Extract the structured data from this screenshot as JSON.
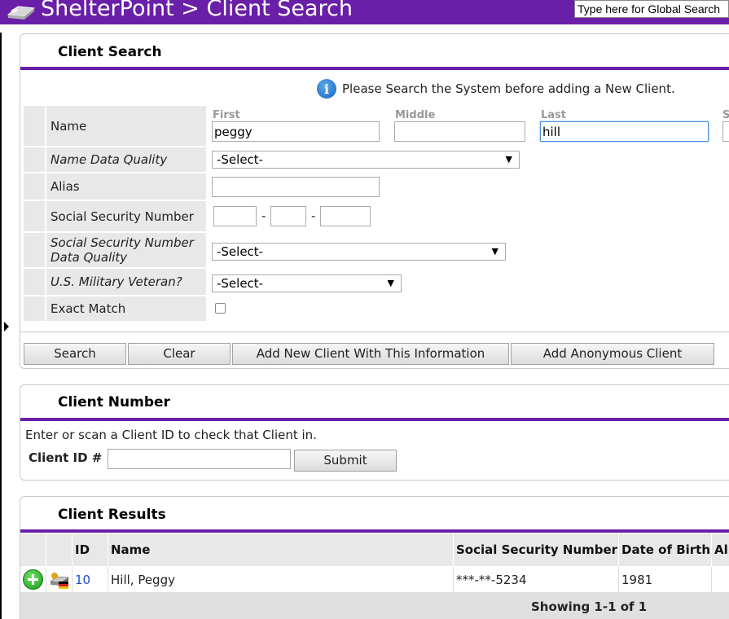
{
  "header": {
    "title": "ShelterPoint > Client Search",
    "global_search_placeholder": "Type here for Global Search"
  },
  "search_panel": {
    "title": "Client Search",
    "info_text": "Please Search the System before adding a New Client.",
    "name": {
      "label": "Name",
      "first_label": "First",
      "first_value": "peggy",
      "middle_label": "Middle",
      "middle_value": "",
      "last_label": "Last",
      "last_value": "hill",
      "suffix_label": "S"
    },
    "name_quality": {
      "label": "Name Data Quality",
      "value": "-Select-"
    },
    "alias": {
      "label": "Alias",
      "value": ""
    },
    "ssn": {
      "label": "Social Security Number",
      "part1": "",
      "part2": "",
      "part3": "",
      "sep": "-"
    },
    "ssn_quality": {
      "label": "Social Security Number Data Quality",
      "value": "-Select-"
    },
    "veteran": {
      "label": "U.S. Military Veteran?",
      "value": "-Select-"
    },
    "exact_match": {
      "label": "Exact Match",
      "checked": false
    },
    "buttons": {
      "search": "Search",
      "clear": "Clear",
      "add_new": "Add New Client With This Information",
      "add_anon": "Add Anonymous Client"
    }
  },
  "number_panel": {
    "title": "Client Number",
    "hint": "Enter or scan a Client ID to check that Client in.",
    "id_label": "Client ID #",
    "id_value": "",
    "submit": "Submit"
  },
  "results_panel": {
    "title": "Client Results",
    "columns": [
      "ID",
      "Name",
      "Social Security Number",
      "Date of Birth",
      "Ali"
    ],
    "rows": [
      {
        "id": "10",
        "name": "Hill, Peggy",
        "ssn": "***-**-5234",
        "dob": "1981",
        "alias": ""
      }
    ],
    "showing": "Showing 1-1 of 1"
  }
}
